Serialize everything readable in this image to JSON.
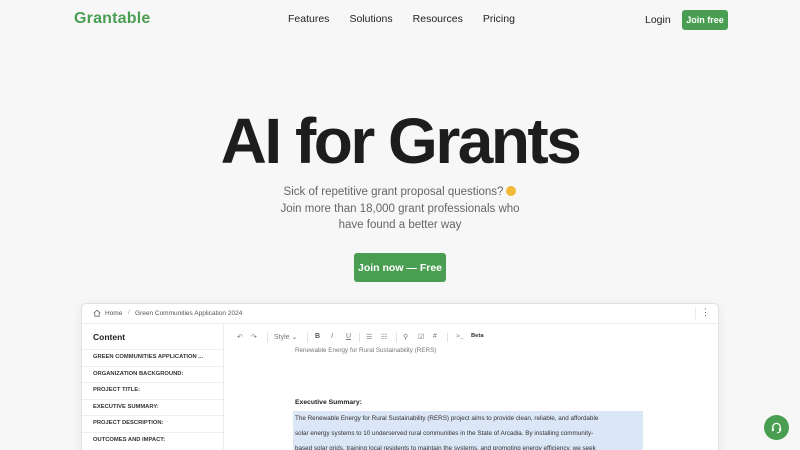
{
  "nav": {
    "logo": "Grantable",
    "links": [
      "Features",
      "Solutions",
      "Resources",
      "Pricing"
    ],
    "login": "Login",
    "join": "Join free"
  },
  "hero": {
    "title": "AI for Grants",
    "sub_line1": "Sick of repetitive grant proposal questions?",
    "sub_line2": "Join more than 18,000 grant professionals who",
    "sub_line3": "have found a better way",
    "cta": "Join now — Free"
  },
  "app": {
    "breadcrumb": {
      "home": "Home",
      "separator": "/",
      "document": "Green Communities Application 2024"
    },
    "sidebar": {
      "title": "Content",
      "items": [
        "GREEN COMMUNITIES APPLICATION ...",
        "ORGANIZATION BACKGROUND:",
        "PROJECT TITLE:",
        "EXECUTIVE SUMMARY:",
        "PROJECT DESCRIPTION:",
        "OUTCOMES AND IMPACT:"
      ]
    },
    "toolbar": {
      "undo": "↶",
      "redo": "↷",
      "style": "Style ⌄",
      "bold": "B",
      "italic": "I",
      "underline": "U",
      "bullet_list": "☰",
      "numbered_list": "☷",
      "link": "⚲",
      "checkbox": "☑",
      "hash": "#",
      "command": ">_",
      "beta": "Beta"
    },
    "editor": {
      "top_text": "Renewable Energy for Rural Sustainability (RERS)",
      "heading": "Executive Summary:",
      "lines": [
        "The Renewable Energy for Rural Sustainability (RERS) project aims to provide clean, reliable, and affordable",
        "solar energy systems to 10 underserved rural communities in the State of Arcadia. By installing community-",
        "based solar grids, training local residents to maintain the systems, and promoting energy efficiency, we seek"
      ]
    }
  },
  "colors": {
    "brand": "#4a9e52",
    "highlight": "#dbe6f7"
  },
  "icons": {
    "home": "home-icon",
    "menu": "more-vertical-icon",
    "help": "headset-icon"
  }
}
